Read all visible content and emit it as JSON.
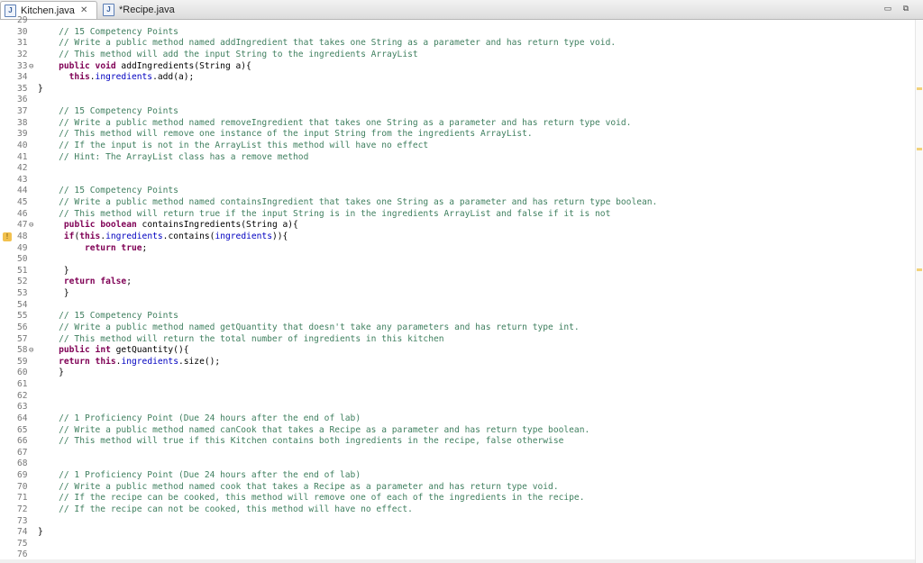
{
  "tabs": [
    {
      "label": "Kitchen.java",
      "icon": "java-file-icon",
      "active": true,
      "close": "✕"
    },
    {
      "label": "*Recipe.java",
      "icon": "java-file-icon",
      "active": false
    }
  ],
  "window_buttons": {
    "minimize": "▭",
    "maximize": "⧉"
  },
  "lines": [
    {
      "n": "29",
      "t": ""
    },
    {
      "n": "30",
      "t": "    // 15 Competency Points",
      "c": "cmt"
    },
    {
      "n": "31",
      "t": "    // Write a public method named addIngredient that takes one String as a parameter and has return type void.",
      "c": "cmt"
    },
    {
      "n": "32",
      "t": "    // This method will add the input String to the ingredients ArrayList",
      "c": "cmt"
    },
    {
      "n": "33",
      "fold": true,
      "t": "    public void addIngredients(String a){",
      "c": "sig"
    },
    {
      "n": "34",
      "t": "      this.ingredients.add(a);",
      "c": "stmt"
    },
    {
      "n": "35",
      "t": "}"
    },
    {
      "n": "36",
      "t": ""
    },
    {
      "n": "37",
      "t": "    // 15 Competency Points",
      "c": "cmt"
    },
    {
      "n": "38",
      "t": "    // Write a public method named removeIngredient that takes one String as a parameter and has return type void.",
      "c": "cmt"
    },
    {
      "n": "39",
      "t": "    // This method will remove one instance of the input String from the ingredients ArrayList.",
      "c": "cmt"
    },
    {
      "n": "40",
      "t": "    // If the input is not in the ArrayList this method will have no effect",
      "c": "cmt"
    },
    {
      "n": "41",
      "t": "    // Hint: The ArrayList class has a remove method",
      "c": "cmt"
    },
    {
      "n": "42",
      "t": ""
    },
    {
      "n": "43",
      "t": ""
    },
    {
      "n": "44",
      "t": "    // 15 Competency Points",
      "c": "cmt"
    },
    {
      "n": "45",
      "t": "    // Write a public method named containsIngredient that takes one String as a parameter and has return type boolean.",
      "c": "cmt"
    },
    {
      "n": "46",
      "t": "    // This method will return true if the input String is in the ingredients ArrayList and false if it is not",
      "c": "cmt"
    },
    {
      "n": "47",
      "fold": true,
      "t": "     public boolean containsIngredients(String a){",
      "c": "sig"
    },
    {
      "n": "48",
      "warn": true,
      "t": "     if(this.ingredients.contains(ingredients)){",
      "c": "stmt"
    },
    {
      "n": "49",
      "t": "         return true;",
      "c": "stmt"
    },
    {
      "n": "50",
      "t": ""
    },
    {
      "n": "51",
      "t": "     }"
    },
    {
      "n": "52",
      "t": "     return false;",
      "c": "stmt"
    },
    {
      "n": "53",
      "t": "     }"
    },
    {
      "n": "54",
      "t": ""
    },
    {
      "n": "55",
      "t": "    // 15 Competency Points",
      "c": "cmt"
    },
    {
      "n": "56",
      "t": "    // Write a public method named getQuantity that doesn't take any parameters and has return type int.",
      "c": "cmt"
    },
    {
      "n": "57",
      "t": "    // This method will return the total number of ingredients in this kitchen",
      "c": "cmt"
    },
    {
      "n": "58",
      "fold": true,
      "t": "    public int getQuantity(){",
      "c": "sig"
    },
    {
      "n": "59",
      "t": "    return this.ingredients.size();",
      "c": "stmt"
    },
    {
      "n": "60",
      "t": "    }"
    },
    {
      "n": "61",
      "t": ""
    },
    {
      "n": "62",
      "t": ""
    },
    {
      "n": "63",
      "t": ""
    },
    {
      "n": "64",
      "t": "    // 1 Proficiency Point (Due 24 hours after the end of lab)",
      "c": "cmt"
    },
    {
      "n": "65",
      "t": "    // Write a public method named canCook that takes a Recipe as a parameter and has return type boolean.",
      "c": "cmt"
    },
    {
      "n": "66",
      "t": "    // This method will true if this Kitchen contains both ingredients in the recipe, false otherwise",
      "c": "cmt"
    },
    {
      "n": "67",
      "t": ""
    },
    {
      "n": "68",
      "t": ""
    },
    {
      "n": "69",
      "t": "    // 1 Proficiency Point (Due 24 hours after the end of lab)",
      "c": "cmt"
    },
    {
      "n": "70",
      "t": "    // Write a public method named cook that takes a Recipe as a parameter and has return type void.",
      "c": "cmt"
    },
    {
      "n": "71",
      "t": "    // If the recipe can be cooked, this method will remove one of each of the ingredients in the recipe.",
      "c": "cmt"
    },
    {
      "n": "72",
      "t": "    // If the recipe can not be cooked, this method will have no effect.",
      "c": "cmt"
    },
    {
      "n": "73",
      "t": ""
    },
    {
      "n": "74",
      "t": "}"
    },
    {
      "n": "75",
      "t": ""
    },
    {
      "n": "76",
      "t": ""
    }
  ],
  "colors": {
    "comment": "#3f7f5f",
    "keyword": "#7f0055",
    "field": "#0000c0",
    "line_number": "#787878"
  }
}
